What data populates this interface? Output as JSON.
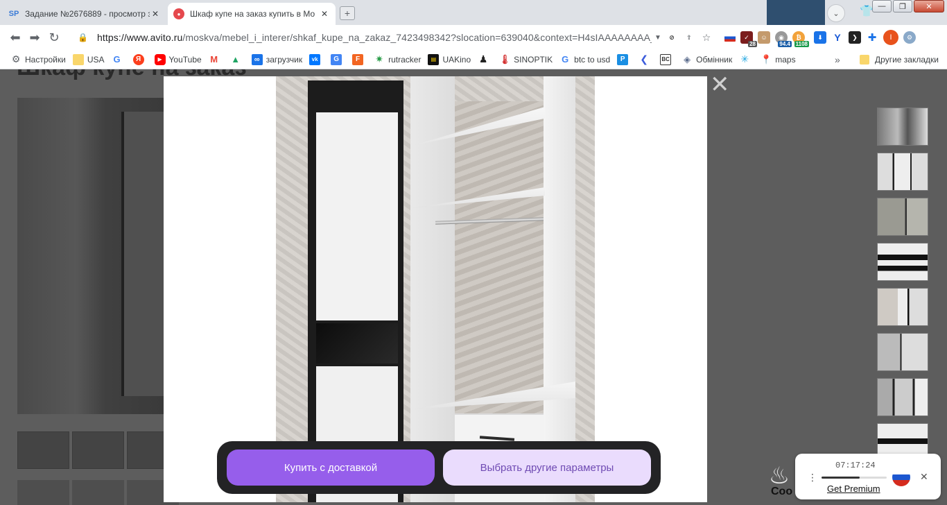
{
  "browser": {
    "tabs": [
      {
        "title": "Задание №2676889 - просмотр з",
        "favicon_text": "SP",
        "active": false
      },
      {
        "title": "Шкаф купе на заказ купить в Мо",
        "favicon_text": "●",
        "active": true
      }
    ],
    "url_prefix": "https://www.avito.ru",
    "url_path": "/moskva/mebel_i_interer/shkaf_kupe_na_zakaz_7423498342?slocation=639040&context=H4sIAAAAAAAA_wE...",
    "extensions": {
      "badge_1": "28",
      "badge_2": "94.4",
      "badge_3": "1108",
      "profile_letter": "I"
    },
    "bookmarks": [
      {
        "label": "Настройки",
        "icon": "gear-icon"
      },
      {
        "label": "USA",
        "icon": "folder-icon"
      },
      {
        "label": "",
        "icon": "google-icon"
      },
      {
        "label": "",
        "icon": "yandex-icon"
      },
      {
        "label": "YouTube",
        "icon": "youtube-icon"
      },
      {
        "label": "",
        "icon": "gmail-icon"
      },
      {
        "label": "",
        "icon": "drive-icon"
      },
      {
        "label": "загрузчик",
        "icon": "loader-icon"
      },
      {
        "label": "",
        "icon": "vk-icon"
      },
      {
        "label": "",
        "icon": "translate-icon"
      },
      {
        "label": "",
        "icon": "f-icon"
      },
      {
        "label": "rutracker",
        "icon": "rutracker-icon"
      },
      {
        "label": "UAKino",
        "icon": "uakino-icon"
      },
      {
        "label": "",
        "icon": "chess-icon"
      },
      {
        "label": "SINOPTIK",
        "icon": "sinoptik-icon"
      },
      {
        "label": "btc to usd",
        "icon": "google-icon"
      },
      {
        "label": "",
        "icon": "p-icon"
      },
      {
        "label": "",
        "icon": "arrow-icon"
      },
      {
        "label": "",
        "icon": "bc-icon"
      },
      {
        "label": "Обмінник",
        "icon": "exchange-icon"
      },
      {
        "label": "",
        "icon": "star-icon"
      },
      {
        "label": "maps",
        "icon": "maps-icon"
      }
    ],
    "other_bookmarks": "Другие закладки",
    "more_bookmarks": "»"
  },
  "page": {
    "title_partial": "Шкаф купе на заказ"
  },
  "gallery": {
    "buy_button": "Купить с доставкой",
    "other_params_button": "Выбрать другие параметры",
    "close_symbol": "✕",
    "thumb_count": 8
  },
  "player": {
    "time": "07:17:24",
    "premium_link": "Get Premium",
    "progress": 0.58
  },
  "cookie_peek": "Coo",
  "colors": {
    "primary": "#965eeb",
    "secondary_bg": "#eadcfd",
    "secondary_text": "#6f4bb3",
    "cta_bar": "#232325"
  }
}
